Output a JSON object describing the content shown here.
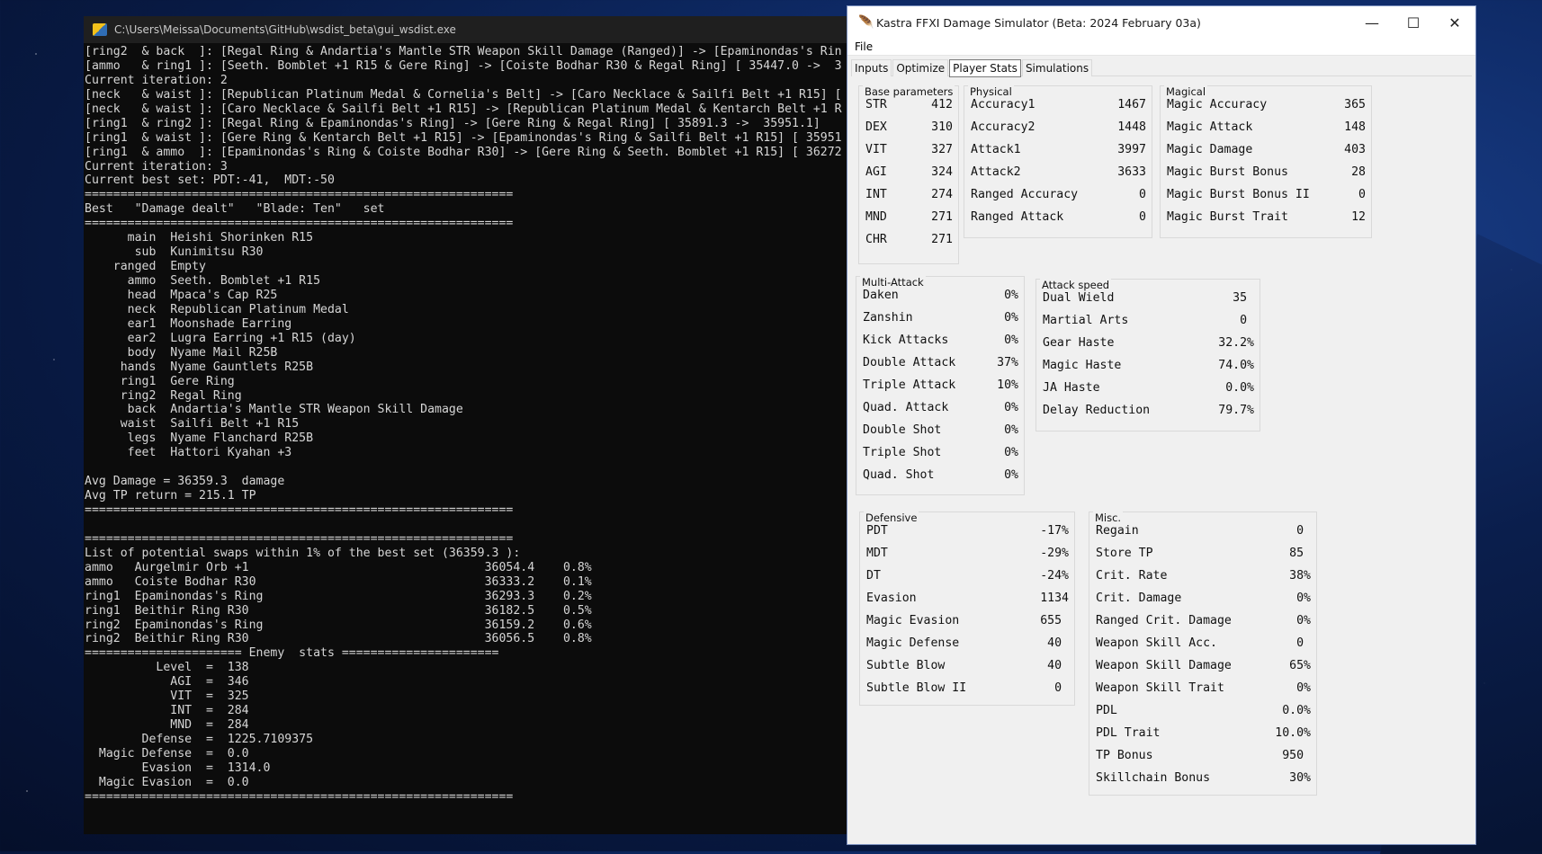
{
  "console": {
    "title": "C:\\Users\\Meissa\\Documents\\GitHub\\wsdist_beta\\gui_wsdist.exe",
    "lines": [
      "[ring2  & back  ]: [Regal Ring & Andartia's Mantle STR Weapon Skill Damage (Ranged)] -> [Epaminondas's Rin",
      "[ammo   & ring1 ]: [Seeth. Bomblet +1 R15 & Gere Ring] -> [Coiste Bodhar R30 & Regal Ring] [ 35447.0 ->  3",
      "Current iteration: 2",
      "[neck   & waist ]: [Republican Platinum Medal & Cornelia's Belt] -> [Caro Necklace & Sailfi Belt +1 R15] [",
      "[neck   & waist ]: [Caro Necklace & Sailfi Belt +1 R15] -> [Republican Platinum Medal & Kentarch Belt +1 R",
      "[ring1  & ring2 ]: [Regal Ring & Epaminondas's Ring] -> [Gere Ring & Regal Ring] [ 35891.3 ->  35951.1]",
      "[ring1  & waist ]: [Gere Ring & Kentarch Belt +1 R15] -> [Epaminondas's Ring & Sailfi Belt +1 R15] [ 35951",
      "[ring1  & ammo  ]: [Epaminondas's Ring & Coiste Bodhar R30] -> [Gere Ring & Seeth. Bomblet +1 R15] [ 36272",
      "Current iteration: 3",
      "Current best set: PDT:-41,  MDT:-50",
      "============================================================",
      "Best   \"Damage dealt\"   \"Blade: Ten\"   set",
      "============================================================",
      "      main  Heishi Shorinken R15",
      "       sub  Kunimitsu R30",
      "    ranged  Empty",
      "      ammo  Seeth. Bomblet +1 R15",
      "      head  Mpaca's Cap R25",
      "      neck  Republican Platinum Medal",
      "      ear1  Moonshade Earring",
      "      ear2  Lugra Earring +1 R15 (day)",
      "      body  Nyame Mail R25B",
      "     hands  Nyame Gauntlets R25B",
      "     ring1  Gere Ring",
      "     ring2  Regal Ring",
      "      back  Andartia's Mantle STR Weapon Skill Damage",
      "     waist  Sailfi Belt +1 R15",
      "      legs  Nyame Flanchard R25B",
      "      feet  Hattori Kyahan +3",
      "",
      "Avg Damage = 36359.3  damage",
      "Avg TP return = 215.1 TP",
      "============================================================",
      "",
      "============================================================",
      "List of potential swaps within 1% of the best set (36359.3 ):",
      "ammo   Aurgelmir Orb +1                                 36054.4    0.8%",
      "ammo   Coiste Bodhar R30                                36333.2    0.1%",
      "ring1  Epaminondas's Ring                               36293.3    0.2%",
      "ring1  Beithir Ring R30                                 36182.5    0.5%",
      "ring2  Epaminondas's Ring                               36159.2    0.6%",
      "ring2  Beithir Ring R30                                 36056.5    0.8%",
      "====================== Enemy  stats ======================",
      "          Level  =  138",
      "            AGI  =  346",
      "            VIT  =  325",
      "            INT  =  284",
      "            MND  =  284",
      "        Defense  =  1225.7109375",
      "  Magic Defense  =  0.0",
      "        Evasion  =  1314.0",
      "  Magic Evasion  =  0.0",
      "============================================================"
    ]
  },
  "app": {
    "title": "Kastra FFXI Damage Simulator (Beta: 2024 February 03a)",
    "menu": [
      "File"
    ],
    "tabs": [
      "Inputs",
      "Optimize",
      "Player Stats",
      "Simulations"
    ],
    "active_tab": "Player Stats",
    "frames": {
      "base": {
        "title": "Base parameters",
        "rows": [
          {
            "label": "STR",
            "value": "412"
          },
          {
            "label": "DEX",
            "value": "310"
          },
          {
            "label": "VIT",
            "value": "327"
          },
          {
            "label": "AGI",
            "value": "324"
          },
          {
            "label": "INT",
            "value": "274"
          },
          {
            "label": "MND",
            "value": "271"
          },
          {
            "label": "CHR",
            "value": "271"
          }
        ]
      },
      "physical": {
        "title": "Physical",
        "rows": [
          {
            "label": "Accuracy1",
            "value": "1467"
          },
          {
            "label": "Accuracy2",
            "value": "1448"
          },
          {
            "label": "Attack1",
            "value": "3997"
          },
          {
            "label": "Attack2",
            "value": "3633"
          },
          {
            "label": "Ranged Accuracy",
            "value": "0"
          },
          {
            "label": "Ranged Attack",
            "value": "0"
          }
        ]
      },
      "magical": {
        "title": "Magical",
        "rows": [
          {
            "label": "Magic Accuracy",
            "value": "365"
          },
          {
            "label": "Magic Attack",
            "value": "148"
          },
          {
            "label": "Magic Damage",
            "value": "403"
          },
          {
            "label": "Magic Burst Bonus",
            "value": "28"
          },
          {
            "label": "Magic Burst Bonus II",
            "value": "0"
          },
          {
            "label": "Magic Burst Trait",
            "value": "12"
          }
        ]
      },
      "multi": {
        "title": "Multi-Attack",
        "rows": [
          {
            "label": "Daken",
            "value": "0%"
          },
          {
            "label": "Zanshin",
            "value": "0%"
          },
          {
            "label": "Kick Attacks",
            "value": "0%"
          },
          {
            "label": "Double Attack",
            "value": "37%"
          },
          {
            "label": "Triple Attack",
            "value": "10%"
          },
          {
            "label": "Quad. Attack",
            "value": "0%"
          },
          {
            "label": "Double Shot",
            "value": "0%"
          },
          {
            "label": "Triple Shot",
            "value": "0%"
          },
          {
            "label": "Quad. Shot",
            "value": "0%"
          }
        ]
      },
      "speed": {
        "title": "Attack speed",
        "rows": [
          {
            "label": "Dual Wield",
            "value": "35 "
          },
          {
            "label": "Martial Arts",
            "value": "0 "
          },
          {
            "label": "Gear Haste",
            "value": "32.2%"
          },
          {
            "label": "Magic Haste",
            "value": "74.0%"
          },
          {
            "label": "JA Haste",
            "value": "0.0%"
          },
          {
            "label": "Delay Reduction",
            "value": "79.7%"
          }
        ]
      },
      "defensive": {
        "title": "Defensive",
        "rows": [
          {
            "label": "PDT",
            "value": "-17%"
          },
          {
            "label": "MDT",
            "value": "-29%"
          },
          {
            "label": "DT",
            "value": "-24%"
          },
          {
            "label": "Evasion",
            "value": "1134"
          },
          {
            "label": "Magic Evasion",
            "value": "655 "
          },
          {
            "label": "Magic Defense",
            "value": "40 "
          },
          {
            "label": "Subtle Blow",
            "value": "40 "
          },
          {
            "label": "Subtle Blow II",
            "value": "0 "
          }
        ]
      },
      "misc": {
        "title": "Misc.",
        "rows": [
          {
            "label": "Regain",
            "value": "0 "
          },
          {
            "label": "Store TP",
            "value": "85 "
          },
          {
            "label": "Crit. Rate",
            "value": "38%"
          },
          {
            "label": "Crit. Damage",
            "value": "0%"
          },
          {
            "label": "Ranged Crit. Damage",
            "value": "0%"
          },
          {
            "label": "Weapon Skill Acc.",
            "value": "0 "
          },
          {
            "label": "Weapon Skill Damage",
            "value": "65%"
          },
          {
            "label": "Weapon Skill Trait",
            "value": "0%"
          },
          {
            "label": "PDL",
            "value": "0.0%"
          },
          {
            "label": "PDL Trait",
            "value": "10.0%"
          },
          {
            "label": "TP Bonus",
            "value": "950 "
          },
          {
            "label": "Skillchain Bonus",
            "value": "30%"
          }
        ]
      }
    }
  }
}
